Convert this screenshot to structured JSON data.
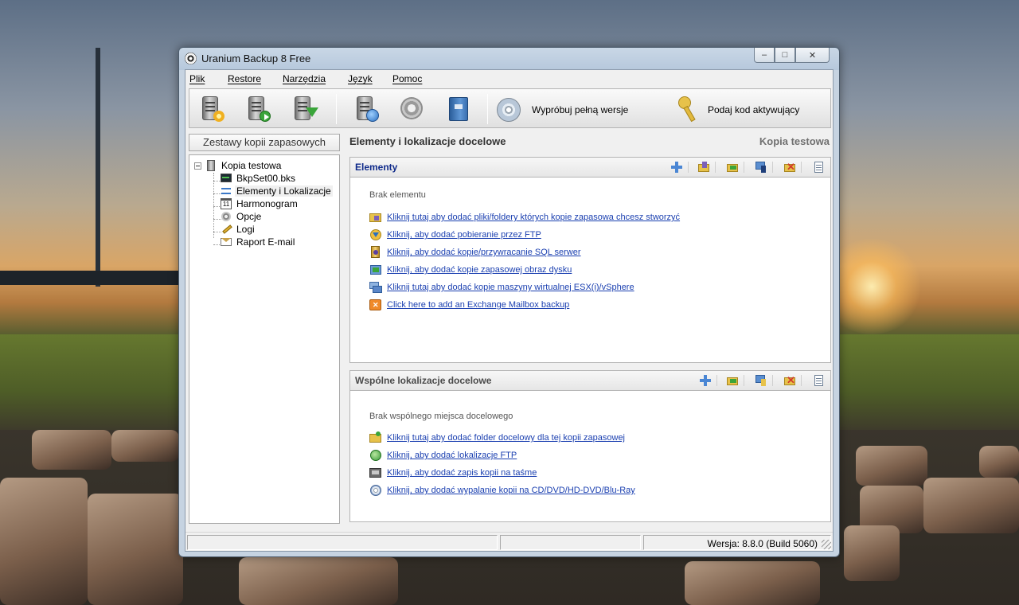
{
  "window": {
    "title": "Uranium Backup 8 Free",
    "controls": {
      "minimize": "–",
      "maximize": "□",
      "close": "✕"
    }
  },
  "menu": [
    "Plik",
    "Restore",
    "Narzędzia",
    "Język",
    "Pomoc"
  ],
  "toolbar": {
    "buttons": [
      {
        "name": "new-backup",
        "icon": "server-star-icon"
      },
      {
        "name": "run-backup",
        "icon": "server-play-icon"
      },
      {
        "name": "restore-backup",
        "icon": "server-down-arrow-icon"
      },
      {
        "name": "network",
        "icon": "server-globe-icon"
      },
      {
        "name": "settings",
        "icon": "gear-icon"
      },
      {
        "name": "help",
        "icon": "book-icon"
      }
    ],
    "try_full": "Wypróbuj pełną wersje",
    "activation": "Podaj kod aktywujący"
  },
  "left": {
    "header": "Zestawy kopii zapasowych",
    "tree": [
      {
        "label": "Kopia testowa",
        "icon": "server-icon",
        "level": 0
      },
      {
        "label": "BkpSet00.bks",
        "icon": "monitor-icon",
        "level": 1
      },
      {
        "label": "Elementy i Lokalizacje",
        "icon": "arrows-icon",
        "level": 1,
        "selected": true
      },
      {
        "label": "Harmonogram",
        "icon": "calendar-icon",
        "level": 1
      },
      {
        "label": "Opcje",
        "icon": "gear-icon",
        "level": 1
      },
      {
        "label": "Logi",
        "icon": "pencil-icon",
        "level": 1
      },
      {
        "label": "Raport E-mail",
        "icon": "envelope-icon",
        "level": 1
      }
    ]
  },
  "right": {
    "title": "Elementy i lokalizacje docelowe",
    "subtitle": "Kopia testowa",
    "elements": {
      "title": "Elementy",
      "empty": "Brak elementu",
      "links": [
        "Kliknij tutaj aby dodać pliki/foldery których kopie zapasowa chcesz stworzyć",
        "Kliknij, aby dodać pobieranie przez FTP",
        "Kliknij, aby dodać kopie/przywracanie SQL serwer",
        "Kliknij, aby dodać kopie zapasowej obraz dysku",
        "Kliknij tutaj aby dodać kopie maszyny wirtualnej ESX(i)/vSphere",
        "Click here to add an Exchange Mailbox backup"
      ]
    },
    "destinations": {
      "title": "Wspólne lokalizacje docelowe",
      "empty": "Brak wspólnego miejsca docelowego",
      "links": [
        "Kliknij tutaj aby dodać folder docelowy dla tej kopii zapasowej",
        "Kliknij, aby dodać lokalizacje FTP",
        "Kliknij, aby dodać zapis kopii na taśme",
        "Kliknij, aby dodać wypalanie kopii na CD/DVD/HD-DVD/Blu-Ray"
      ]
    }
  },
  "status": {
    "version": "Wersja: 8.8.0 (Build 5060)"
  },
  "colors": {
    "link": "#1a3fb0",
    "elements_title": "#0f2a8a",
    "accent_green": "#3aa53a",
    "accent_red": "#d23b2b"
  }
}
